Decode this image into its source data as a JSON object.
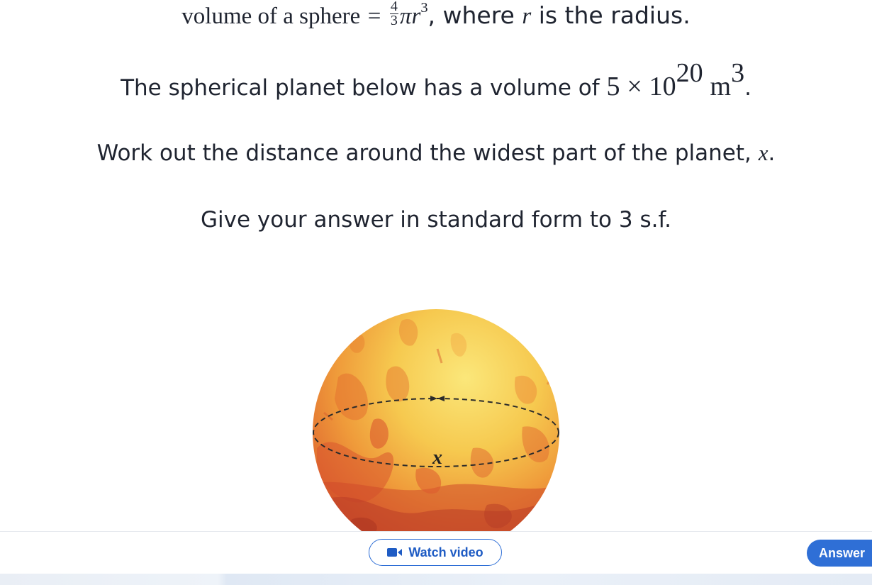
{
  "question": {
    "line1": {
      "prefix": "volume of a sphere",
      "equals": "=",
      "frac_num": "4",
      "frac_den": "3",
      "pi": "π",
      "r": "r",
      "exp": "3",
      "suffix": ", where ",
      "r2": "r",
      "suffix2": " is the radius."
    },
    "line2": {
      "prefix": "The spherical planet below has a volume of ",
      "coef": "5",
      "times": "×",
      "base": "10",
      "exp": "20",
      "unit": "m",
      "unit_exp": "3",
      "suffix": "."
    },
    "line3": {
      "prefix": "Work out the distance around the widest part of the planet, ",
      "var": "x",
      "suffix": "."
    },
    "line4": "Give your answer in standard form to 3 s.f."
  },
  "diagram": {
    "label": "x",
    "colors": {
      "planet_light": "#f9dd63",
      "planet_mid": "#f2a33a",
      "planet_dark": "#c8432a",
      "dashes": "#2b2b2b"
    }
  },
  "footer": {
    "watch_video_label": "Watch video",
    "answer_label": "Answer",
    "accent": "#2f6fd6"
  }
}
